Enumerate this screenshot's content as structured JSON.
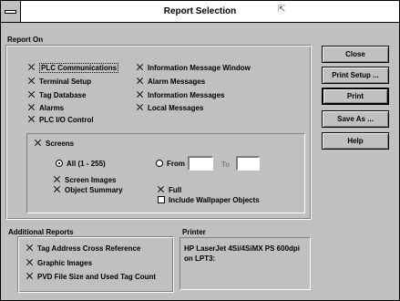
{
  "window": {
    "title": "Report Selection"
  },
  "report_on": {
    "heading": "Report On",
    "left_items": [
      {
        "label": "PLC Communications",
        "checked": true
      },
      {
        "label": "Terminal Setup",
        "checked": true
      },
      {
        "label": "Tag Database",
        "checked": true
      },
      {
        "label": "Alarms",
        "checked": true
      },
      {
        "label": "PLC I/O Control",
        "checked": true
      }
    ],
    "right_items": [
      {
        "label": "Information Message Window",
        "checked": true
      },
      {
        "label": "Alarm Messages",
        "checked": true
      },
      {
        "label": "Information Messages",
        "checked": true
      },
      {
        "label": "Local Messages",
        "checked": true
      }
    ]
  },
  "screens": {
    "label": "Screens",
    "checked": true,
    "all_label": "All (1 - 255)",
    "all_selected": true,
    "from_label": "From",
    "from_value": "",
    "to_label": "To",
    "to_value": "",
    "screen_images": "Screen Images",
    "object_summary": "Object Summary",
    "full": "Full",
    "include_wallpaper": "Include Wallpaper Objects"
  },
  "additional_reports": {
    "heading": "Additional Reports",
    "items": [
      {
        "label": "Tag Address Cross Reference",
        "checked": true
      },
      {
        "label": "Graphic Images",
        "checked": true
      },
      {
        "label": "PVD File Size and Used Tag Count",
        "checked": true
      }
    ]
  },
  "printer": {
    "heading": "Printer",
    "line1": "HP LaserJet 4Si/4SiMX PS 600dpi",
    "line2": "on LPT3:"
  },
  "buttons": {
    "close": "Close",
    "print_setup": "Print Setup ...",
    "print": "Print",
    "save_as": "Save As ...",
    "help": "Help"
  }
}
